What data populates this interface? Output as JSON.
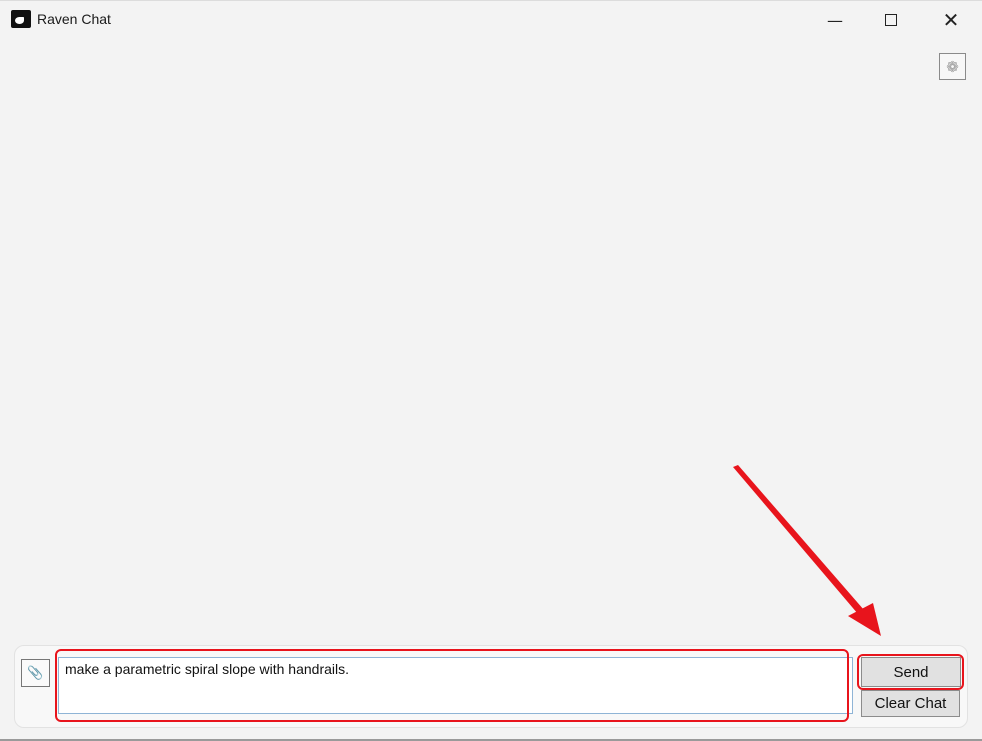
{
  "window": {
    "title": "Raven Chat",
    "minimize_icon": "minimize-icon",
    "maximize_icon": "maximize-icon",
    "close_icon": "close-icon"
  },
  "toolbar": {
    "settings_icon": "gear-icon"
  },
  "composer": {
    "attach_icon": "paperclip-icon",
    "input_value": "make a parametric spiral slope with handrails.",
    "send_label": "Send",
    "clear_label": "Clear Chat"
  },
  "annotation": {
    "highlight_color": "#e8141c"
  }
}
